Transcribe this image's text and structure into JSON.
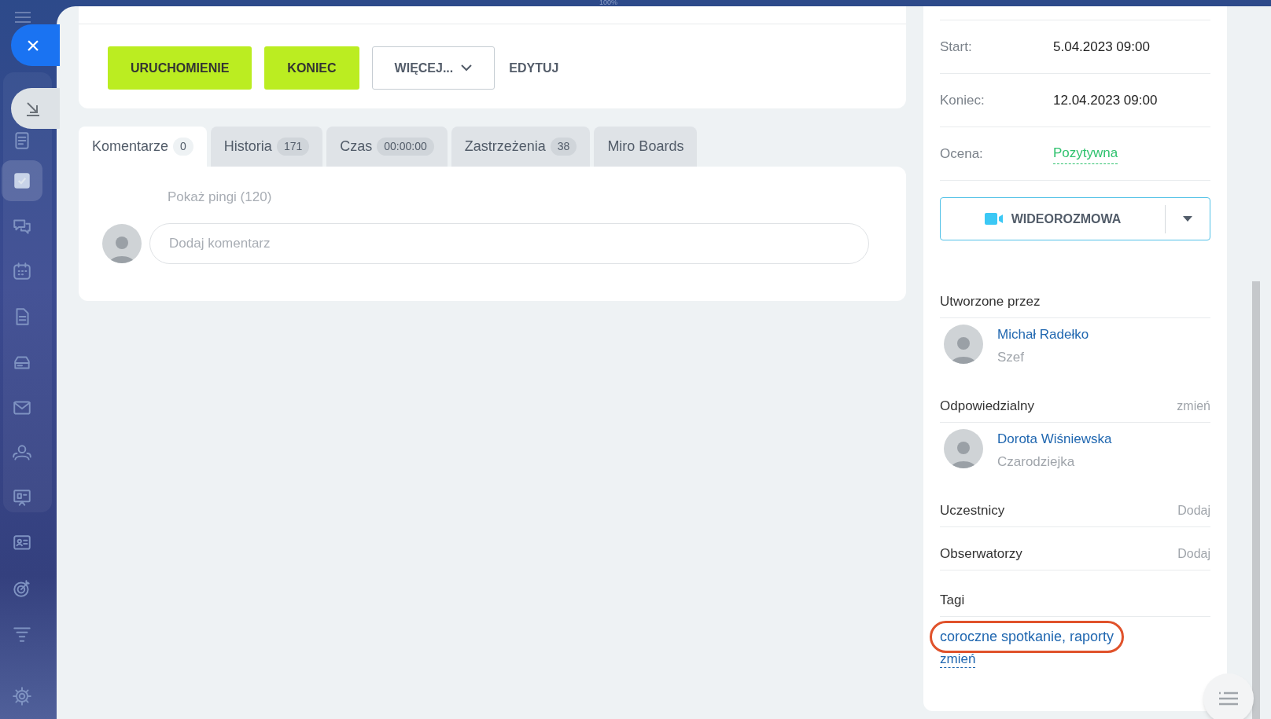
{
  "zoom_indicator": "100%",
  "sidebar": {
    "close_button": {
      "icon": "×"
    },
    "items": [
      {
        "kind": "feed",
        "selected": false
      },
      {
        "kind": "tasks",
        "selected": true
      },
      {
        "kind": "chat",
        "selected": false
      },
      {
        "kind": "calendar",
        "selected": false
      },
      {
        "kind": "docs",
        "selected": false
      },
      {
        "kind": "drive",
        "selected": false
      },
      {
        "kind": "mail",
        "selected": false
      },
      {
        "kind": "groups",
        "selected": false
      },
      {
        "kind": "board",
        "selected": false
      },
      {
        "kind": "contacts",
        "selected": false
      },
      {
        "kind": "target",
        "selected": false
      },
      {
        "kind": "funnel",
        "selected": false
      },
      {
        "kind": "settings",
        "selected": false
      }
    ]
  },
  "actions": [
    {
      "kind": "primary",
      "label": "URUCHOMIENIE"
    },
    {
      "kind": "primary",
      "label": "KONIEC"
    },
    {
      "kind": "dropdown",
      "label": "WIĘCEJ..."
    },
    {
      "kind": "link",
      "label": "EDYTUJ"
    }
  ],
  "tabs": [
    {
      "label": "Komentarze",
      "count": "0",
      "selected": true
    },
    {
      "label": "Historia",
      "count": "171",
      "selected": false
    },
    {
      "label": "Czas",
      "count": "00:00:00",
      "selected": false
    },
    {
      "label": "Zastrzeżenia",
      "count": "38",
      "selected": false
    },
    {
      "label": "Miro Boards",
      "selected": false
    }
  ],
  "comments": {
    "show_pings": "Pokaż pingi (120)",
    "placeholder": "Dodaj komentarz"
  },
  "details": [
    {
      "label": "Start:",
      "value": "5.04.2023 09:00",
      "kind": "plain"
    },
    {
      "label": "Koniec:",
      "value": "12.04.2023 09:00",
      "kind": "plain"
    },
    {
      "label": "Ocena:",
      "value": "Pozytywna",
      "kind": "rating"
    }
  ],
  "video_button": {
    "label": "WIDEOROZMOWA"
  },
  "sections": [
    {
      "title": "Utworzone przez",
      "person": {
        "name": "Michał Radełko",
        "role": "Szef"
      }
    },
    {
      "title": "Odpowiedzialny",
      "action": "zmień",
      "person": {
        "name": "Dorota Wiśniewska",
        "role": "Czarodziejka"
      }
    },
    {
      "title": "Uczestnicy",
      "action": "Dodaj"
    },
    {
      "title": "Obserwatorzy",
      "action": "Dodaj"
    }
  ],
  "tags": {
    "title": "Tagi",
    "value": "coroczne spotkanie, raporty",
    "highlighted": true,
    "change": "zmień"
  }
}
